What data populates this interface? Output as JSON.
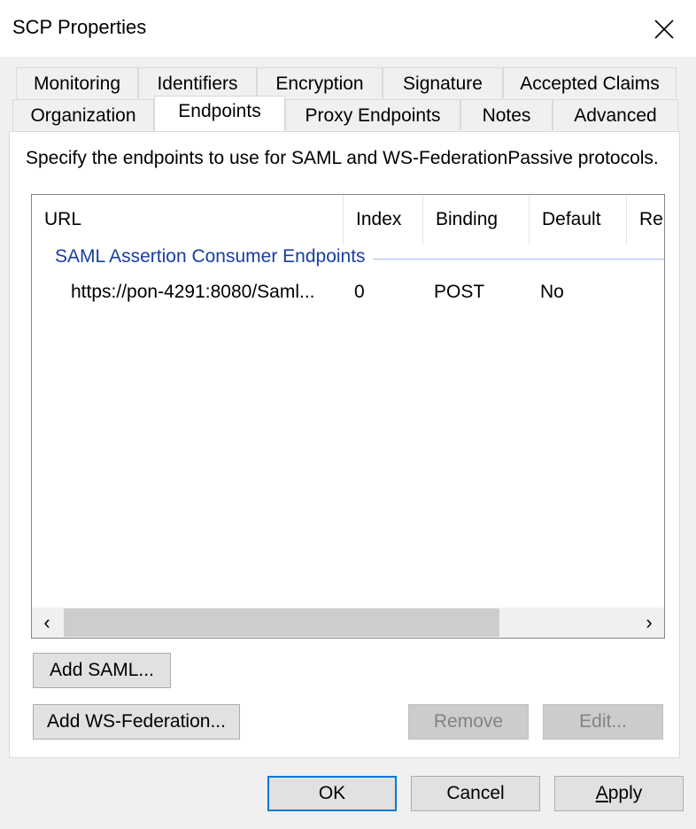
{
  "window": {
    "title": "SCP Properties",
    "close_icon": "close-icon"
  },
  "tabs": {
    "row_back": [
      "Monitoring",
      "Identifiers",
      "Encryption",
      "Signature",
      "Accepted Claims"
    ],
    "row_front": [
      "Organization",
      "Endpoints",
      "Proxy Endpoints",
      "Notes",
      "Advanced"
    ],
    "selected": "Endpoints"
  },
  "endpoints_page": {
    "description": "Specify the endpoints to use for SAML and WS-FederationPassive protocols.",
    "list": {
      "columns": [
        "URL",
        "Index",
        "Binding",
        "Default",
        "Re"
      ],
      "group_label": "SAML Assertion Consumer Endpoints",
      "rows": [
        {
          "url": "https://pon-4291:8080/Saml...",
          "index": "0",
          "binding": "POST",
          "default": "No"
        }
      ],
      "scroll_left_icon": "‹",
      "scroll_right_icon": "›"
    },
    "buttons": {
      "add_saml": "Add SAML...",
      "add_ws_federation": "Add WS-Federation...",
      "remove": "Remove",
      "edit": "Edit..."
    }
  },
  "dialog_buttons": {
    "ok": "OK",
    "cancel": "Cancel",
    "apply": "Apply"
  },
  "colors": {
    "group_label": "#1a3e9e",
    "default_button_border": "#0078d7"
  }
}
